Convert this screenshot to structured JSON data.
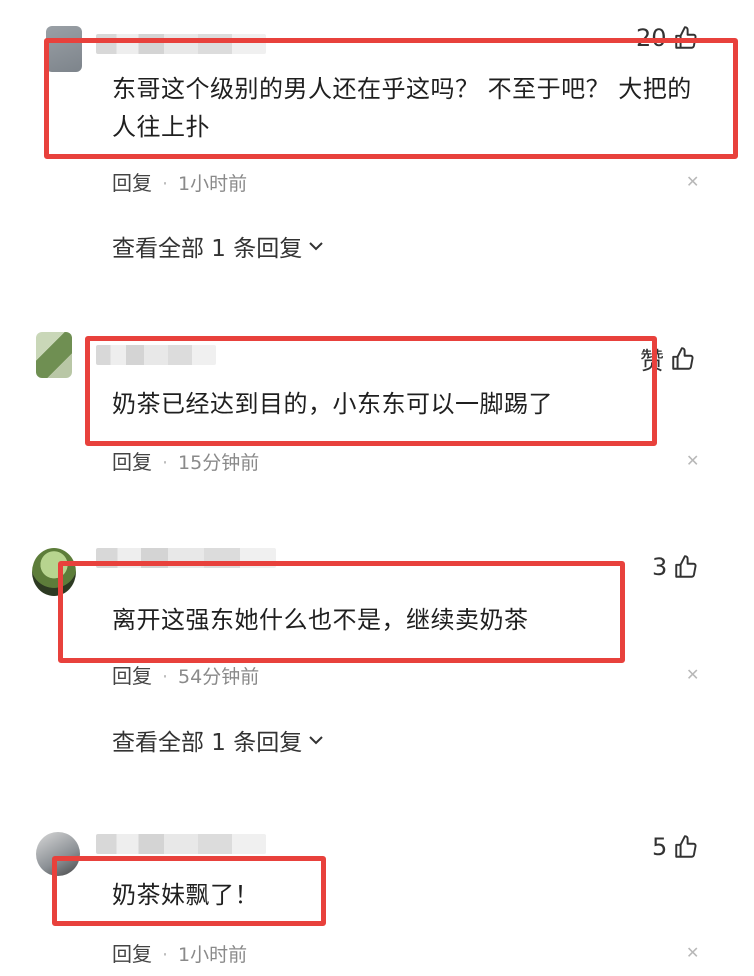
{
  "comments": [
    {
      "text_line1": "东哥这个级别的男人还在乎这吗？ 不至于吧？ 大把的",
      "text_line2": "人往上扑",
      "likes": "20",
      "reply_label": "回复",
      "time": "1小时前",
      "view_replies": "查看全部 1 条回复"
    },
    {
      "text_line1": "奶茶已经达到目的，小东东可以一脚踢了",
      "likes": "赞",
      "reply_label": "回复",
      "time": "15分钟前"
    },
    {
      "text_line1": "离开这强东她什么也不是，继续卖奶茶",
      "likes": "3",
      "reply_label": "回复",
      "time": "54分钟前",
      "view_replies": "查看全部 1 条回复"
    },
    {
      "text_line1": "奶茶妹飘了！",
      "likes": "5",
      "reply_label": "回复",
      "time": "1小时前"
    }
  ],
  "icons": {
    "like": "thumbs-up-icon",
    "close": "close-icon",
    "expand": "chevron-down-icon"
  },
  "colors": {
    "highlight_box": "#e8413c",
    "meta_text": "#8a8a8a"
  }
}
